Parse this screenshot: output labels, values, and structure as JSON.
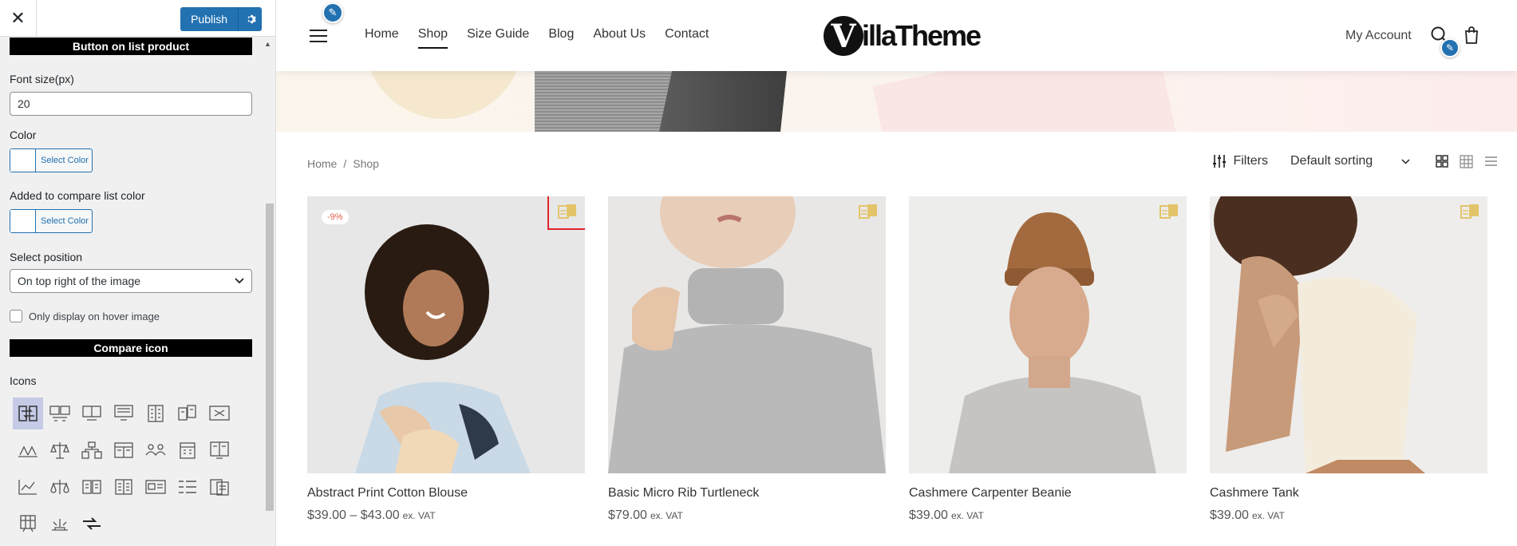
{
  "panel": {
    "close_glyph": "✕",
    "publish_label": "Publish",
    "section_button": "Button on list product",
    "font_size_label": "Font size(px)",
    "font_size_value": "20",
    "color_label": "Color",
    "select_color_label": "Select Color",
    "added_color_label": "Added to compare list color",
    "select_color_label_2": "Select Color",
    "position_label": "Select position",
    "position_value": "On top right of the image",
    "hover_label": "Only display on hover image",
    "section_compare_icon": "Compare icon",
    "icons_label": "Icons",
    "accent_color": "#2271b1",
    "icon_names": [
      "arrows-compare-icon",
      "boxes-compare-icon",
      "monitor-compare-icon",
      "screen-compare-icon",
      "table-compare-icon",
      "docs-compare-icon",
      "devices-compare-icon",
      "scale-compare-icon",
      "balance-compare-icon",
      "hierarchy-compare-icon",
      "cards-compare-icon",
      "people-compare-icon",
      "calendar-compare-icon",
      "panels-compare-icon",
      "chart-compare-icon",
      "weight-compare-icon",
      "pages-compare-icon",
      "list-compare-icon",
      "image-compare-icon",
      "rows-compare-icon",
      "files-compare-icon",
      "bars-compare-icon",
      "podium-compare-icon",
      "exchange-compare-icon"
    ]
  },
  "site": {
    "nav": [
      "Home",
      "Shop",
      "Size Guide",
      "Blog",
      "About Us",
      "Contact"
    ],
    "active_nav": "Shop",
    "logo_letter": "V",
    "logo_text": "illaTheme",
    "my_account": "My Account",
    "breadcrumb": [
      "Home",
      "/",
      "Shop"
    ],
    "filters_label": "Filters",
    "sorting_label": "Default sorting",
    "products": [
      {
        "name": "Abstract Print Cotton Blouse",
        "price": "$39.00 – $43.00",
        "vat": "ex. VAT",
        "badge": "-9%"
      },
      {
        "name": "Basic Micro Rib Turtleneck",
        "price": "$79.00",
        "vat": "ex. VAT",
        "badge": ""
      },
      {
        "name": "Cashmere Carpenter Beanie",
        "price": "$39.00",
        "vat": "ex. VAT",
        "badge": ""
      },
      {
        "name": "Cashmere Tank",
        "price": "$39.00",
        "vat": "ex. VAT",
        "badge": ""
      }
    ],
    "compare_icon_color": "#e3c46a",
    "highlight_color": "#e0232b"
  }
}
